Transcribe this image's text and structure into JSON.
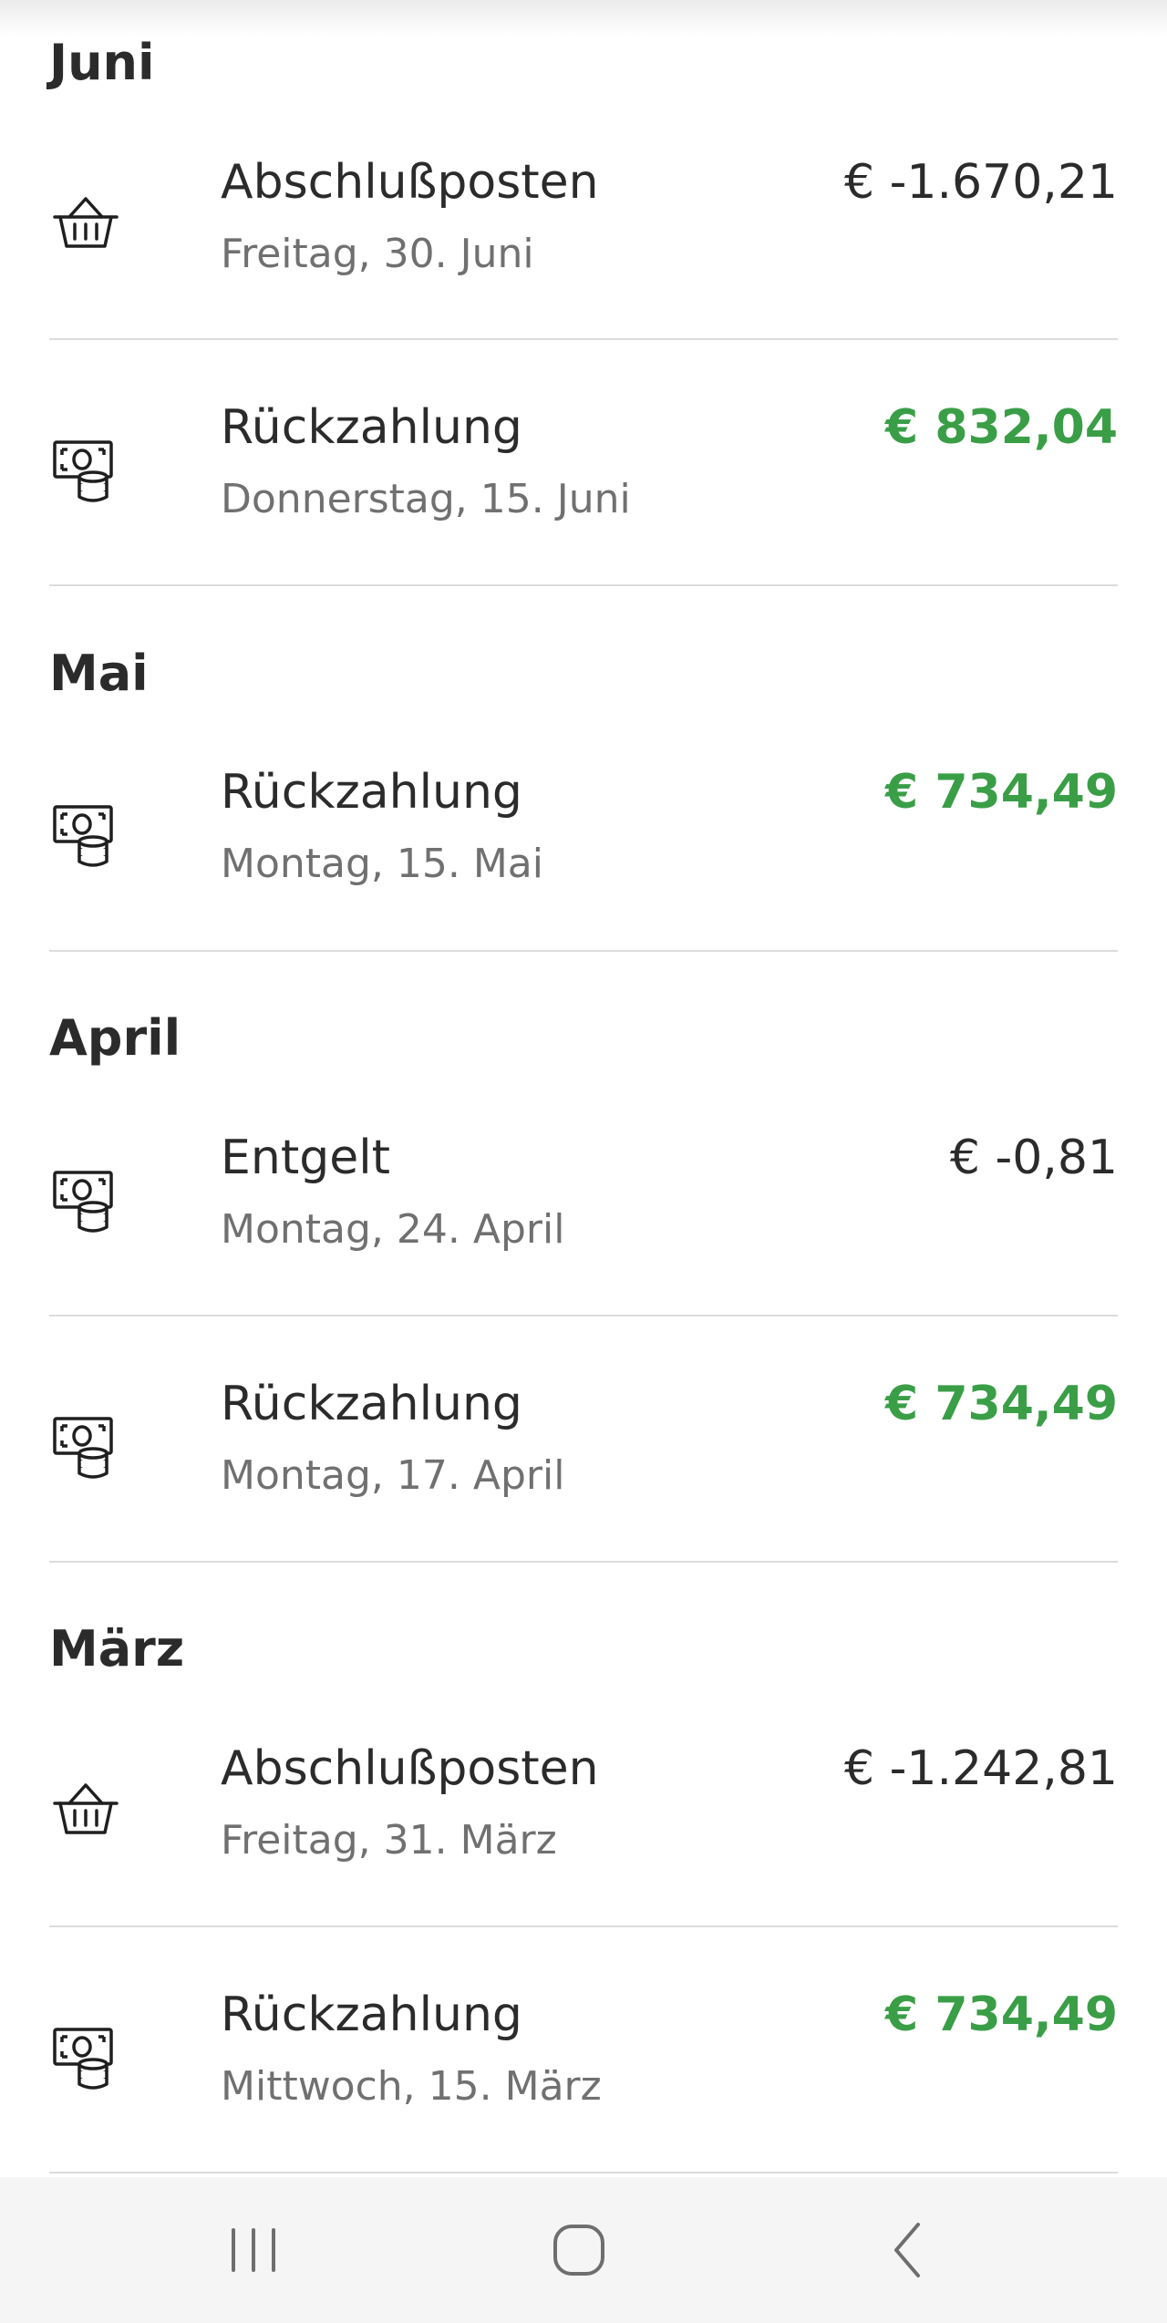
{
  "months": [
    {
      "name": "Juni",
      "transactions": [
        {
          "icon": "basket-icon",
          "title": "Abschlußposten",
          "date": "Freitag, 30. Juni",
          "amount": "€ -1.670,21",
          "positive": false
        },
        {
          "icon": "money-coins-icon",
          "title": "Rückzahlung",
          "date": "Donnerstag, 15. Juni",
          "amount": "€ 832,04",
          "positive": true
        }
      ]
    },
    {
      "name": "Mai",
      "transactions": [
        {
          "icon": "money-coins-icon",
          "title": "Rückzahlung",
          "date": "Montag, 15. Mai",
          "amount": "€ 734,49",
          "positive": true
        }
      ]
    },
    {
      "name": "April",
      "transactions": [
        {
          "icon": "money-coins-icon",
          "title": "Entgelt",
          "date": "Montag, 24. April",
          "amount": "€ -0,81",
          "positive": false
        },
        {
          "icon": "money-coins-icon",
          "title": "Rückzahlung",
          "date": "Montag, 17. April",
          "amount": "€ 734,49",
          "positive": true
        }
      ]
    },
    {
      "name": "März",
      "transactions": [
        {
          "icon": "basket-icon",
          "title": "Abschlußposten",
          "date": "Freitag, 31. März",
          "amount": "€ -1.242,81",
          "positive": false
        },
        {
          "icon": "money-coins-icon",
          "title": "Rückzahlung",
          "date": "Mittwoch, 15. März",
          "amount": "€ 734,49",
          "positive": true
        }
      ]
    }
  ],
  "navbar": {
    "icons": [
      "recent-apps-icon",
      "home-icon",
      "back-icon"
    ]
  },
  "colors": {
    "positive_amount": "#3a9e47",
    "text": "#2b2b2b",
    "secondary_text": "#707070",
    "divider": "#dcdcdc",
    "navbar_bg": "#f5f5f5"
  }
}
